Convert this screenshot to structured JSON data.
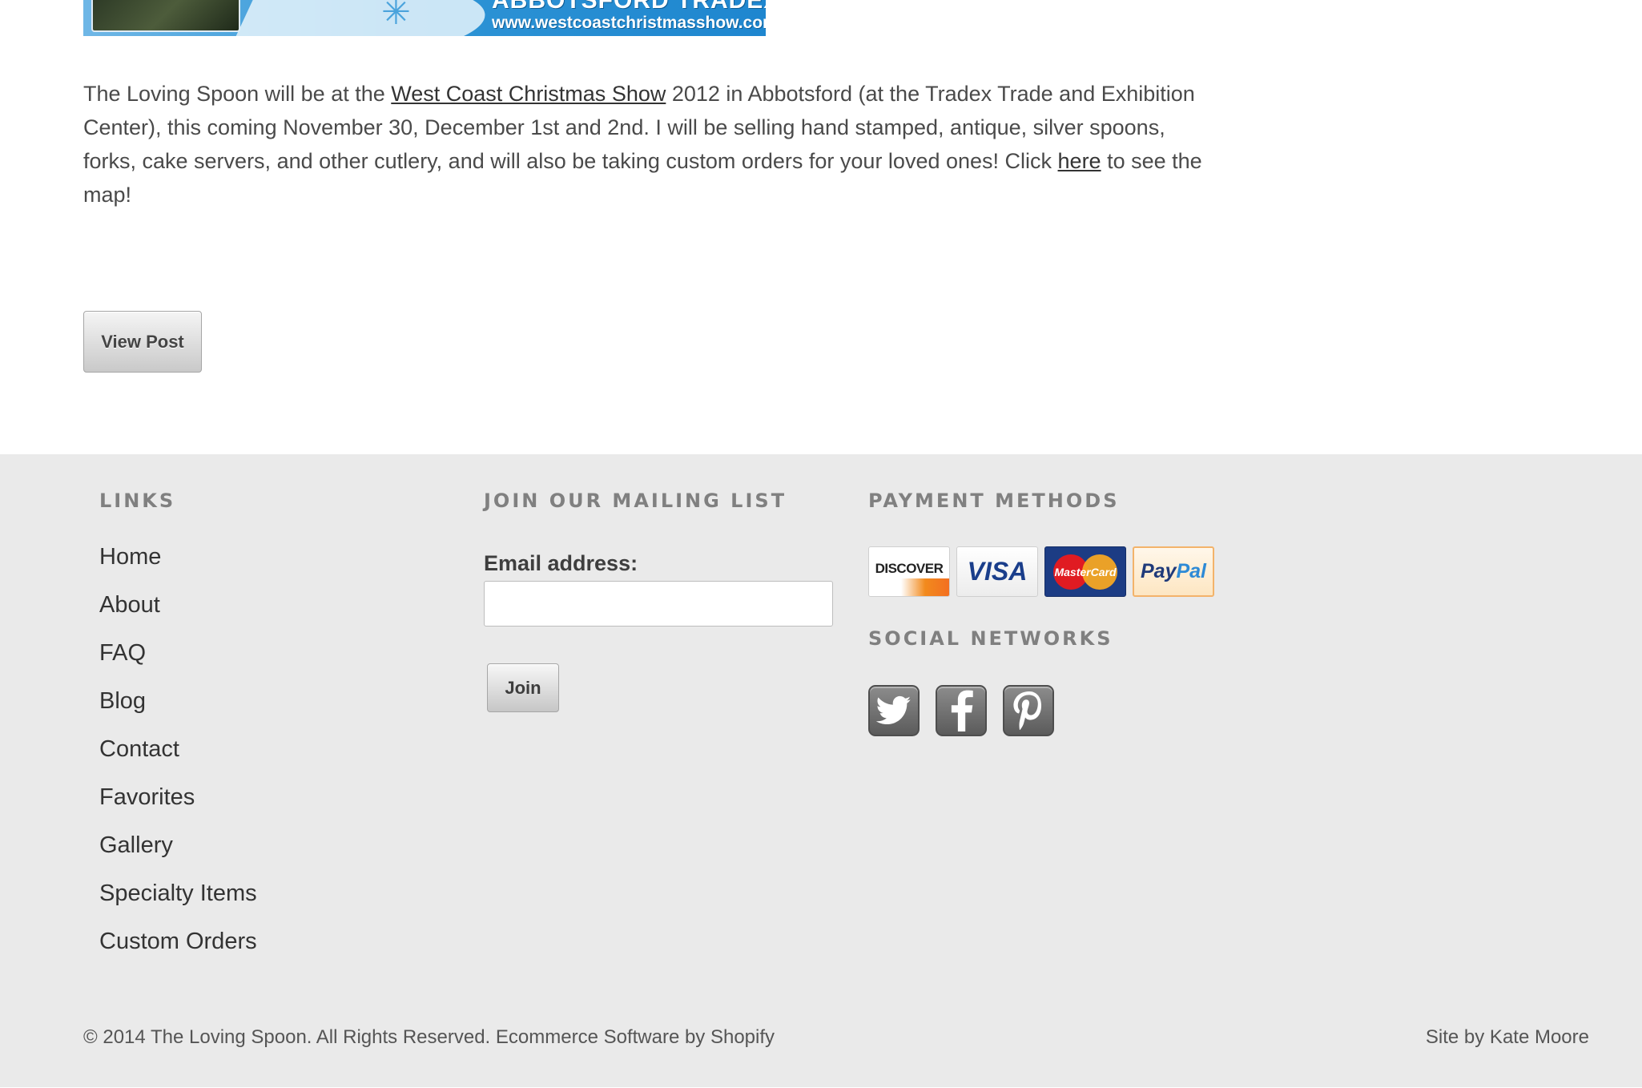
{
  "banner": {
    "title": "ABBOTSFORD TRADEX",
    "url": "www.westcoastchristmasshow.com"
  },
  "post": {
    "text_1": "The Loving Spoon will be at the ",
    "link_show": "West Coast Christmas Show",
    "text_2": " 2012 in Abbotsford (at the Tradex Trade and Exhibition Center), this coming November 30, December 1st and 2nd. I will be selling hand stamped, antique, silver spoons, forks, cake servers, and other cutlery, and will also be taking custom orders for your loved ones! Click ",
    "link_here": "here",
    "text_3": " to see the map!",
    "view_post_label": "View Post"
  },
  "footer": {
    "links_heading": "LINKS",
    "links": [
      {
        "label": "Home"
      },
      {
        "label": "About"
      },
      {
        "label": "FAQ"
      },
      {
        "label": "Blog"
      },
      {
        "label": "Contact"
      },
      {
        "label": "Favorites"
      },
      {
        "label": "Gallery"
      },
      {
        "label": "Specialty Items"
      },
      {
        "label": "Custom Orders"
      }
    ],
    "mailing_heading": "JOIN OUR MAILING LIST",
    "email_label": "Email address:",
    "email_value": "",
    "join_label": "Join",
    "payment_heading": "PAYMENT METHODS",
    "payment_methods": [
      {
        "label": "DISCOVER",
        "icon": "discover-card-icon"
      },
      {
        "label": "VISA",
        "icon": "visa-card-icon"
      },
      {
        "label": "MasterCard",
        "icon": "mastercard-icon"
      },
      {
        "label_a": "Pay",
        "label_b": "Pal",
        "icon": "paypal-icon"
      }
    ],
    "social_heading": "SOCIAL NETWORKS",
    "social": [
      {
        "icon": "twitter-icon"
      },
      {
        "icon": "facebook-icon"
      },
      {
        "icon": "pinterest-icon"
      }
    ],
    "copyright": "© 2014 The Loving Spoon. All Rights Reserved. Ecommerce Software by Shopify",
    "site_by": "Site by Kate Moore"
  },
  "colors": {
    "footer_bg": "#eaeaea",
    "heading_gray": "#808080",
    "text": "#333333"
  }
}
